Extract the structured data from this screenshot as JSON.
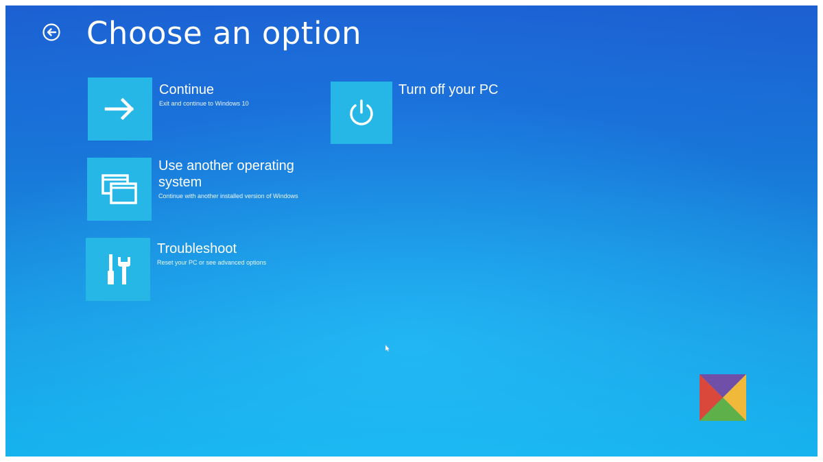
{
  "header": {
    "title": "Choose an option",
    "back_icon": "back-arrow-circle-icon"
  },
  "options": [
    {
      "title": "Continue",
      "description": "Exit and continue to Windows 10",
      "icon": "arrow-right-icon"
    },
    {
      "title": "Use another operating system",
      "description": "Continue with another installed version of Windows",
      "icon": "windows-stack-icon"
    },
    {
      "title": "Troubleshoot",
      "description": "Reset your PC or see advanced options",
      "icon": "tools-icon"
    },
    {
      "title": "Turn off your PC",
      "description": "",
      "icon": "power-icon"
    }
  ],
  "colors": {
    "background_top": "#1c5fd2",
    "background_bottom": "#15b2ee",
    "tile": "#27b7e6",
    "text": "#ffffff"
  },
  "watermark": {
    "icon": "colored-x-logo-icon"
  }
}
